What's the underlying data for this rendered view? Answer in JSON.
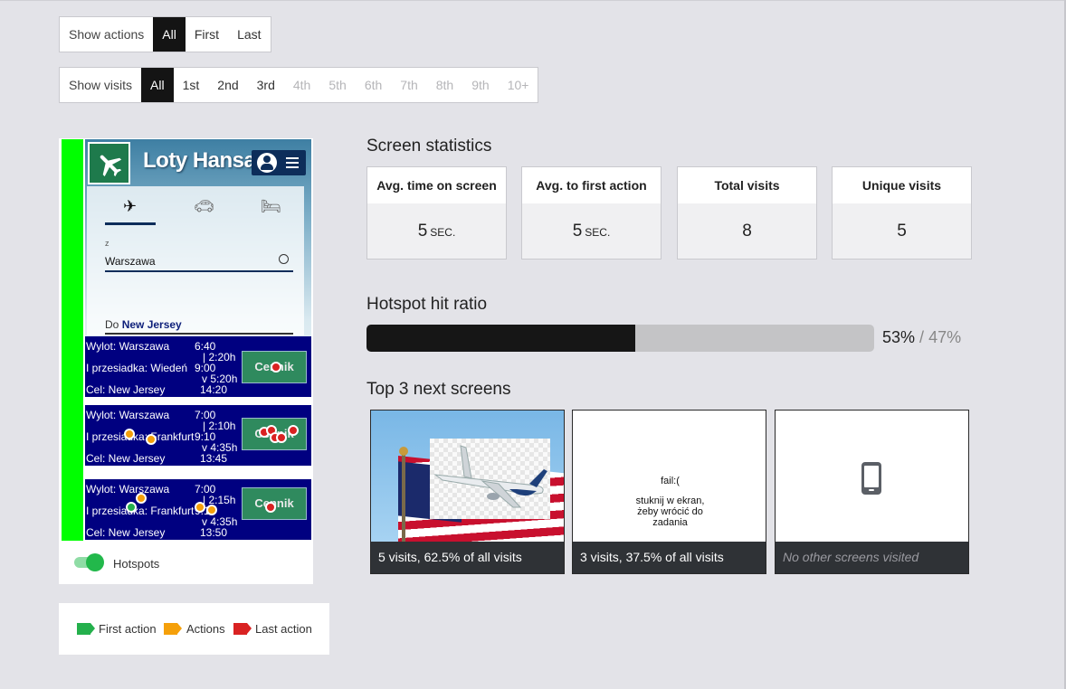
{
  "show_actions": {
    "label": "Show actions",
    "options": [
      "All",
      "First",
      "Last"
    ],
    "selected": "All"
  },
  "show_visits": {
    "label": "Show visits",
    "options": [
      "All",
      "1st",
      "2nd",
      "3rd",
      "4th",
      "5th",
      "6th",
      "7th",
      "8th",
      "9th",
      "10+"
    ],
    "selected": "All",
    "disabled": [
      "4th",
      "5th",
      "6th",
      "7th",
      "8th",
      "9th",
      "10+"
    ]
  },
  "preview": {
    "app_brand": "Loty Hansa",
    "from_label": "z",
    "from_value": "Warszawa",
    "to_label": "Do",
    "to_value": "New Jersey",
    "icons": [
      "plane-icon",
      "car-icon",
      "bed-icon",
      "account-icon",
      "menu-icon",
      "locate-icon"
    ],
    "flights": [
      {
        "dep": "Wylot: Warszawa",
        "dep_time": "6:40",
        "dur1": "| 2:20h",
        "mid": "I przesiadka: Wiedeń",
        "mid_time": "9:00",
        "dur2": "v 5:20h",
        "arr": "Cel: New Jersey",
        "arr_time": "14:20",
        "btn": "Cennik"
      },
      {
        "dep": "Wylot: Warszawa",
        "dep_time": "7:00",
        "dur1": "| 2:10h",
        "mid": "I przesiadka: Frankfurt",
        "mid_time": "9:10",
        "dur2": "v 4:35h",
        "arr": "Cel: New Jersey",
        "arr_time": "13:45",
        "btn": "Cennik"
      },
      {
        "dep": "Wylot: Warszawa",
        "dep_time": "7:00",
        "dur1": "| 2:15h",
        "mid": "I przesiadka: Frankfurt",
        "mid_time": "9:15",
        "dur2": "v 4:35h",
        "arr": "Cel: New Jersey",
        "arr_time": "13:50",
        "btn": "Cennik"
      }
    ]
  },
  "hotspots": {
    "label": "Hotspots",
    "enabled": true
  },
  "legend": {
    "first": "First action",
    "actions": "Actions",
    "last": "Last action",
    "colors": {
      "first": "#24b04c",
      "actions": "#f5a00a",
      "last": "#d92222"
    }
  },
  "screen_statistics": {
    "title": "Screen statistics",
    "cards": [
      {
        "label": "Avg. time on screen",
        "value": "5",
        "unit": "SEC."
      },
      {
        "label": "Avg. to first action",
        "value": "5",
        "unit": "SEC."
      },
      {
        "label": "Total visits",
        "value": "8",
        "unit": ""
      },
      {
        "label": "Unique visits",
        "value": "5",
        "unit": ""
      }
    ]
  },
  "hotspot_ratio": {
    "title": "Hotspot hit ratio",
    "hit_fraction": 0.53,
    "hit_text": "53%",
    "separator": "/",
    "miss_text": "47%"
  },
  "next_screens": {
    "title": "Top 3 next screens",
    "items": [
      {
        "caption": "5 visits, 62.5% of all visits"
      },
      {
        "caption": "3 visits, 37.5% of all visits",
        "screen_text": [
          "fail:(",
          "stuknij w ekran,",
          "żeby wrócić do",
          "zadania"
        ]
      },
      {
        "caption": "No other screens visited"
      }
    ]
  }
}
